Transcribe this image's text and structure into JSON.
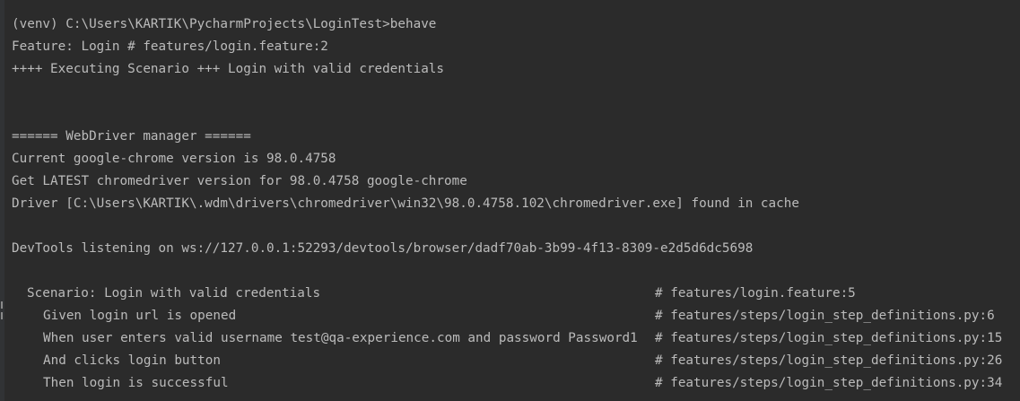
{
  "terminal": {
    "lines": [
      "(venv) C:\\Users\\KARTIK\\PycharmProjects\\LoginTest>behave",
      "Feature: Login # features/login.feature:2",
      "++++ Executing Scenario +++ Login with valid credentials",
      "",
      "",
      "====== WebDriver manager ======",
      "Current google-chrome version is 98.0.4758",
      "Get LATEST chromedriver version for 98.0.4758 google-chrome",
      "Driver [C:\\Users\\KARTIK\\.wdm\\drivers\\chromedriver\\win32\\98.0.4758.102\\chromedriver.exe] found in cache",
      "",
      "DevTools listening on ws://127.0.0.1:52293/devtools/browser/dadf70ab-3b99-4f13-8309-e2d5d6dc5698",
      ""
    ],
    "scenario": {
      "text": "Scenario: Login with valid credentials",
      "comment": "# features/login.feature:5"
    },
    "steps": [
      {
        "text": "Given login url is opened",
        "comment": "# features/steps/login_step_definitions.py:6"
      },
      {
        "text": "When user enters valid username test@qa-experience.com and password Password1",
        "comment": "# features/steps/login_step_definitions.py:15"
      },
      {
        "text": "And clicks login button",
        "comment": "# features/steps/login_step_definitions.py:26"
      },
      {
        "text": "Then login is successful",
        "comment": "# features/steps/login_step_definitions.py:34"
      }
    ],
    "partial_line": "  ------------------------------------------------"
  }
}
